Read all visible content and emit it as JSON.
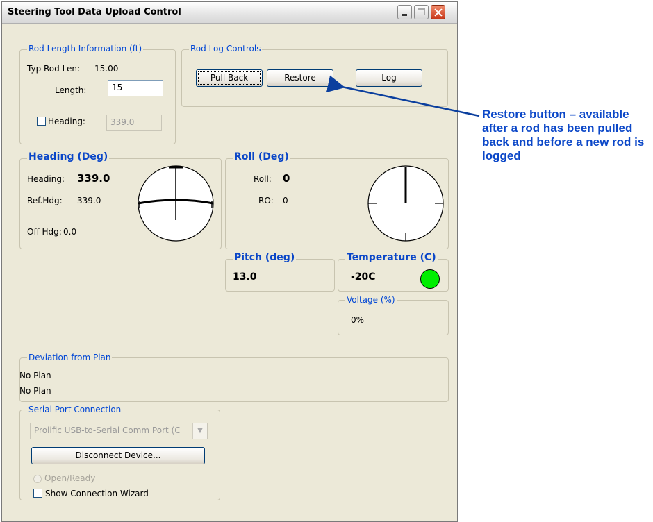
{
  "window": {
    "title": "Steering Tool Data Upload Control"
  },
  "rod_length": {
    "legend": "Rod Length Information (ft)",
    "typ_label": "Typ Rod Len:",
    "typ_value": "15.00",
    "length_label": "Length:",
    "length_value": "15",
    "heading_label": "Heading:",
    "heading_checked": false,
    "heading_value": "339.0"
  },
  "rod_log": {
    "legend": "Rod Log Controls",
    "pull_back": "Pull Back",
    "restore": "Restore",
    "log": "Log"
  },
  "heading": {
    "legend": "Heading (Deg)",
    "heading_label": "Heading:",
    "heading_value": "339.0",
    "ref_label": "Ref.Hdg:",
    "ref_value": "339.0",
    "off_label": "Off Hdg:",
    "off_value": "0.0"
  },
  "roll": {
    "legend": "Roll (Deg)",
    "roll_label": "Roll:",
    "roll_value": "0",
    "ro_label": "RO:",
    "ro_value": "0"
  },
  "pitch": {
    "legend": "Pitch (deg)",
    "value": "13.0"
  },
  "temperature": {
    "legend": "Temperature (C)",
    "value": "-20C",
    "indicator_color": "#00ee00"
  },
  "voltage": {
    "legend": "Voltage (%)",
    "value": "0%"
  },
  "deviation": {
    "legend": "Deviation from Plan",
    "line1": "No Plan",
    "line2": "No Plan"
  },
  "serial": {
    "legend": "Serial Port Connection",
    "port_selected": "Prolific USB-to-Serial Comm Port (C",
    "disconnect": "Disconnect Device...",
    "open_ready": "Open/Ready",
    "show_wizard": "Show Connection Wizard",
    "show_wizard_checked": false
  },
  "callout": {
    "text": "Restore button – available after a rod has been pulled back and before a new rod is logged",
    "color": "#0b47c8"
  }
}
